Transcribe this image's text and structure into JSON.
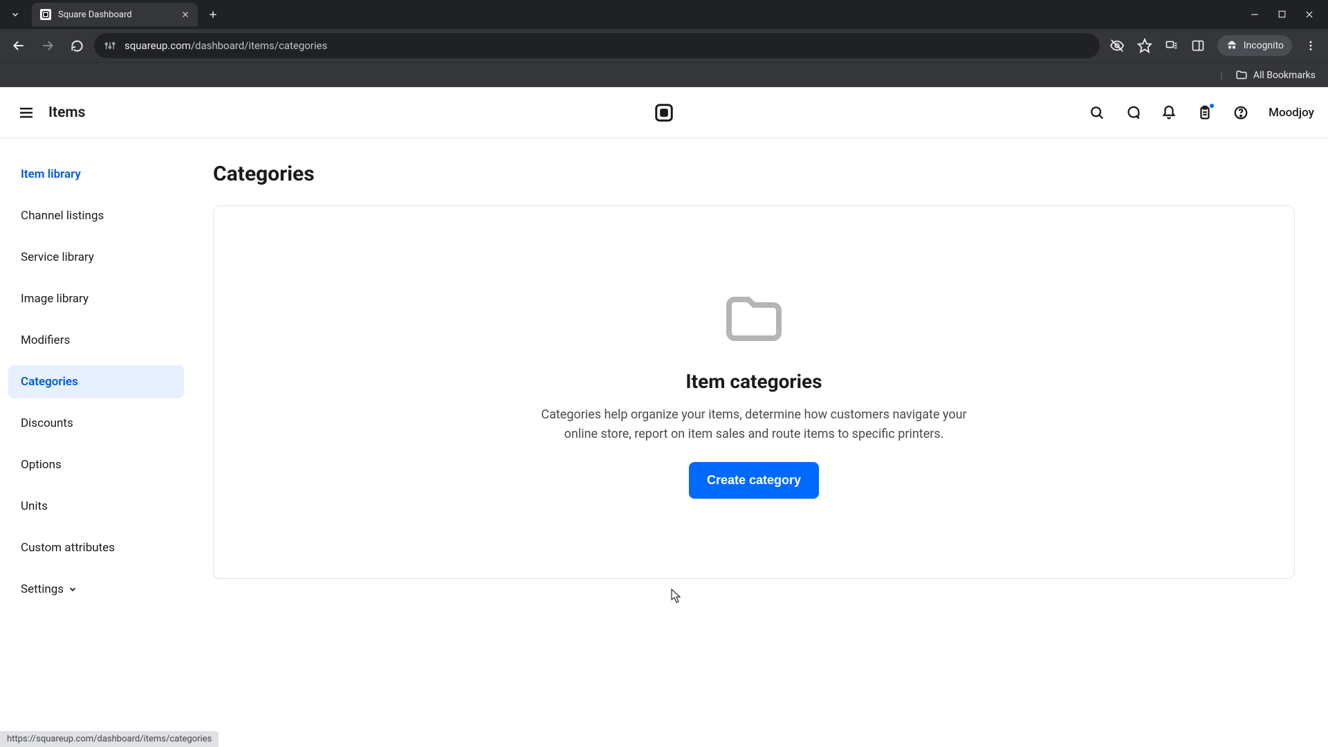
{
  "browser": {
    "tab_title": "Square Dashboard",
    "url_host": "squareup.com",
    "url_path": "/dashboard/items/categories",
    "incognito_label": "Incognito",
    "all_bookmarks": "All Bookmarks",
    "status_url": "https://squareup.com/dashboard/items/categories"
  },
  "header": {
    "section": "Items",
    "username": "Moodjoy"
  },
  "sidebar": {
    "items": [
      {
        "label": "Item library"
      },
      {
        "label": "Channel listings"
      },
      {
        "label": "Service library"
      },
      {
        "label": "Image library"
      },
      {
        "label": "Modifiers"
      },
      {
        "label": "Categories"
      },
      {
        "label": "Discounts"
      },
      {
        "label": "Options"
      },
      {
        "label": "Units"
      },
      {
        "label": "Custom attributes"
      },
      {
        "label": "Settings"
      }
    ]
  },
  "main": {
    "page_title": "Categories",
    "empty_title": "Item categories",
    "empty_desc": "Categories help organize your items, determine how customers navigate your online store, report on item sales and route items to specific printers.",
    "cta": "Create category"
  }
}
